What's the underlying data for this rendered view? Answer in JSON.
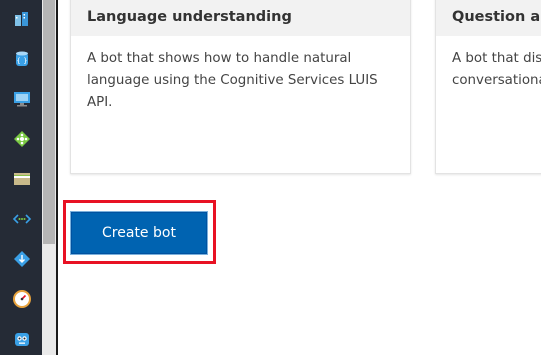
{
  "sidebar": {
    "icons": [
      "buildings-icon",
      "database-icon",
      "monitor-icon",
      "diamond-network-icon",
      "card-icon",
      "code-arrows-icon",
      "diamond-download-icon",
      "gauge-icon",
      "bot-face-icon"
    ]
  },
  "cards": [
    {
      "title": "Language understanding",
      "description": "A bot that shows how to handle natural language using the Cognitive Services LUIS API."
    },
    {
      "title": "Question and",
      "description_lines": [
        "A bot that dis",
        "conversationa"
      ]
    }
  ],
  "actions": {
    "create_bot_label": "Create bot"
  },
  "colors": {
    "accent": "#0063b1",
    "highlight": "#e81123",
    "rail": "#252b36"
  }
}
